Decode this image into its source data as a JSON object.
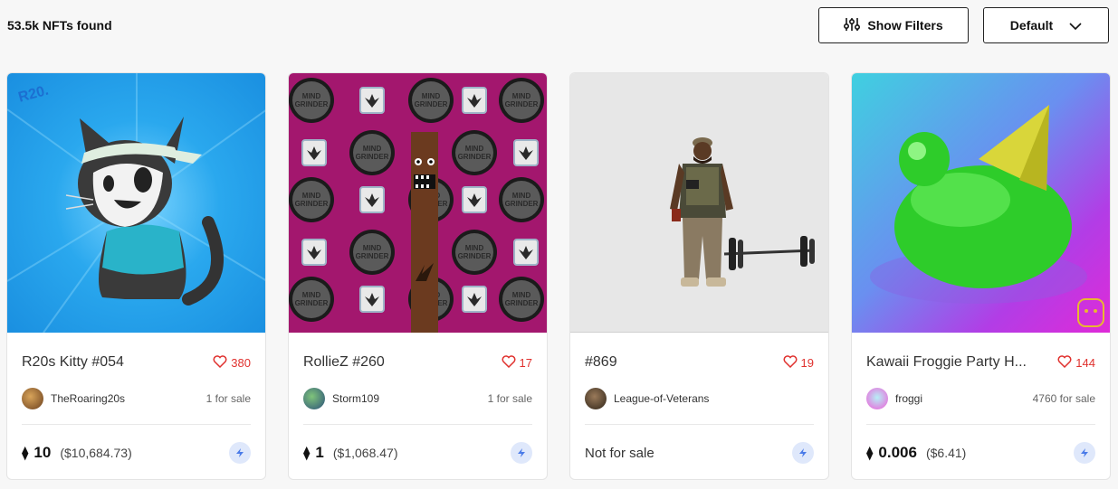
{
  "results": {
    "count_label": "53.5k NFTs found"
  },
  "toolbar": {
    "filters_label": "Show Filters",
    "sort_label": "Default"
  },
  "colors": {
    "like": "#e0312e",
    "chain_bg": "#dfe8fb",
    "chain_fg": "#4a7be8"
  },
  "cards": [
    {
      "title": "R20s Kitty #054",
      "likes": "380",
      "owner": "TheRoaring20s",
      "sale": "1 for sale",
      "currency": "⧫",
      "price": "10",
      "usd": "($10,684.73)",
      "art_icon": "cat-artwork",
      "art_badge": "R20."
    },
    {
      "title": "RollieZ #260",
      "likes": "17",
      "owner": "Storm109",
      "sale": "1 for sale",
      "currency": "⧫",
      "price": "1",
      "usd": "($1,068.47)",
      "art_icon": "grinder-pattern-artwork",
      "art_tile_text": "MIND GRINDER"
    },
    {
      "title": "#869",
      "likes": "19",
      "owner": "League-of-Veterans",
      "sale": "",
      "not_for_sale": "Not for sale",
      "art_icon": "soldier-artwork"
    },
    {
      "title": "Kawaii Froggie Party H...",
      "likes": "144",
      "owner": "froggi",
      "sale": "4760 for sale",
      "currency": "⧫",
      "price": "0.006",
      "usd": "($6.41)",
      "art_icon": "frog-party-hat-artwork"
    }
  ]
}
